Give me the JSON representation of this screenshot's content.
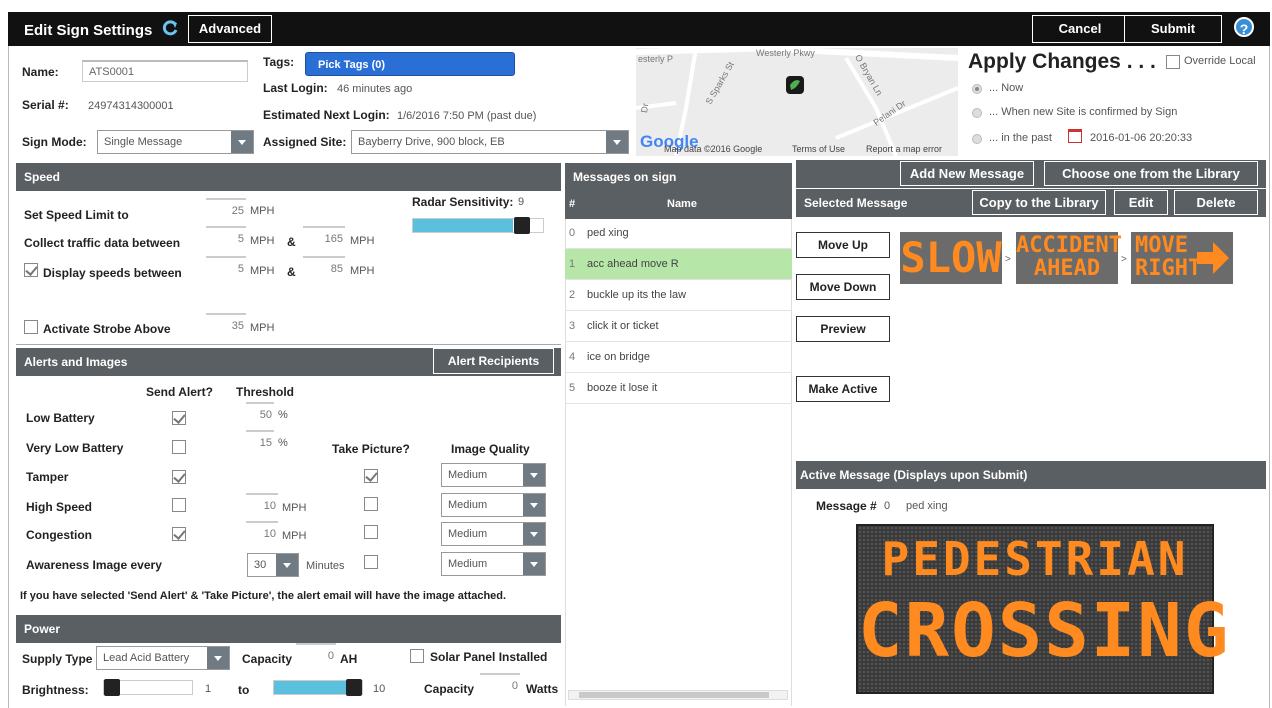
{
  "header": {
    "title": "Edit Sign Settings",
    "advanced": "Advanced",
    "cancel": "Cancel",
    "submit": "Submit"
  },
  "info": {
    "name_label": "Name:",
    "name": "ATS0001",
    "serial_label": "Serial #:",
    "serial": "24974314300001",
    "mode_label": "Sign Mode:",
    "mode": "Single Message",
    "tags_label": "Tags:",
    "tags_btn": "Pick Tags (0)",
    "last_login_label": "Last Login:",
    "last_login": "46 minutes ago",
    "next_login_label": "Estimated Next Login:",
    "next_login": "1/6/2016 7:50 PM (past due)",
    "site_label": "Assigned Site:",
    "site": "Bayberry Drive, 900 block, EB"
  },
  "map": {
    "streets": [
      "Westerly Pkwy",
      "S Sparks St",
      "O Bryan Ln",
      "Pelani Dr",
      "Dr",
      "esterly P"
    ],
    "logo": "Google",
    "data": "Map data ©2016 Google",
    "terms": "Terms of Use",
    "report": "Report a map error"
  },
  "apply": {
    "title": "Apply Changes . . .",
    "override": "Override Local",
    "now": "... Now",
    "confirm": "... When new Site is confirmed by Sign",
    "past": "... in the past",
    "past_date": "2016-01-06 20:20:33"
  },
  "speed": {
    "title": "Speed",
    "limit_label": "Set Speed Limit to",
    "limit": "25",
    "mph": "MPH",
    "collect_label": "Collect traffic data between",
    "collect_min": "5",
    "collect_max": "165",
    "amp": "&",
    "display_label": "Display speeds between",
    "display_min": "5",
    "display_max": "85",
    "strobe_label": "Activate Strobe Above",
    "strobe": "35",
    "radar_label": "Radar Sensitivity:",
    "radar": "9"
  },
  "alerts": {
    "title": "Alerts and Images",
    "recipients": "Alert Recipients",
    "send_col": "Send Alert?",
    "threshold_col": "Threshold",
    "picture_col": "Take Picture?",
    "quality_col": "Image Quality",
    "rows": [
      {
        "label": "Low Battery",
        "send": true,
        "threshold": "50",
        "unit": "%"
      },
      {
        "label": "Very Low Battery",
        "send": false,
        "threshold": "15",
        "unit": "%"
      },
      {
        "label": "Tamper",
        "send": true,
        "threshold": "",
        "unit": "",
        "picture": true,
        "quality": "Medium"
      },
      {
        "label": "High Speed",
        "send": false,
        "threshold": "10",
        "unit": "MPH",
        "picture": false,
        "quality": "Medium"
      },
      {
        "label": "Congestion",
        "send": true,
        "threshold": "10",
        "unit": "MPH",
        "picture": false,
        "quality": "Medium"
      },
      {
        "label": "Awareness Image every",
        "threshold": "30",
        "unit": "Minutes",
        "picture": false,
        "quality": "Medium"
      }
    ],
    "note": "If you have selected 'Send Alert' & 'Take Picture', the alert email will have the image attached."
  },
  "power": {
    "title": "Power",
    "supply_label": "Supply Type",
    "supply": "Lead Acid Battery",
    "capacity_label": "Capacity",
    "capacity": "0",
    "ah": "AH",
    "solar": "Solar Panel Installed",
    "brightness_label": "Brightness:",
    "bright_min": "1",
    "to": "to",
    "bright_max": "10",
    "capacity2_label": "Capacity",
    "capacity2": "0",
    "watts": "Watts"
  },
  "messages": {
    "title": "Messages on sign",
    "hash": "#",
    "name_col": "Name",
    "items": [
      {
        "num": "0",
        "name": "ped xing"
      },
      {
        "num": "1",
        "name": "acc ahead move R"
      },
      {
        "num": "2",
        "name": "buckle up its the law"
      },
      {
        "num": "3",
        "name": "click it or ticket"
      },
      {
        "num": "4",
        "name": "ice on bridge"
      },
      {
        "num": "5",
        "name": "booze it lose it"
      }
    ]
  },
  "selected": {
    "add_new": "Add New Message",
    "choose_lib": "Choose one from the Library",
    "title": "Selected Message",
    "copy_lib": "Copy to the Library",
    "edit": "Edit",
    "delete": "Delete",
    "move_up": "Move Up",
    "move_down": "Move Down",
    "preview": "Preview",
    "make_active": "Make Active",
    "frames": [
      "SLOW",
      "ACCIDENT",
      "AHEAD",
      "MOVE",
      "RIGHT"
    ],
    "sep": ">"
  },
  "active": {
    "title": "Active Message (Displays upon Submit)",
    "msg_label": "Message #",
    "msg_num": "0",
    "msg_name": "ped xing",
    "line1": "PEDESTRIAN",
    "line2": "CROSSING"
  },
  "colors": {
    "header": "#111111",
    "section": "#5a5f63",
    "accent": "#5bc0de",
    "selected_row": "#b6e6a8",
    "led": "#ff8a1f"
  }
}
